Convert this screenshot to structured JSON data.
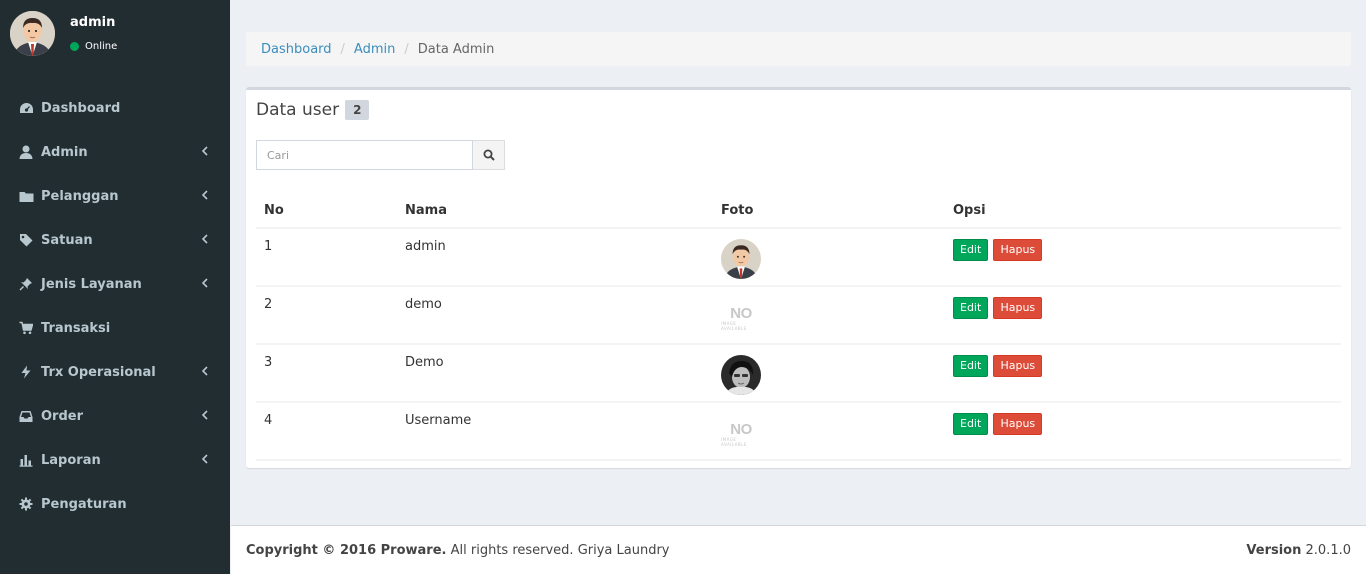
{
  "user": {
    "name": "admin",
    "status": "Online"
  },
  "sidebar": {
    "items": [
      {
        "label": "Dashboard",
        "icon": "dashboard-icon",
        "has_submenu": false
      },
      {
        "label": "Admin",
        "icon": "user-icon",
        "has_submenu": true
      },
      {
        "label": "Pelanggan",
        "icon": "folder-icon",
        "has_submenu": true
      },
      {
        "label": "Satuan",
        "icon": "tag-icon",
        "has_submenu": true
      },
      {
        "label": "Jenis Layanan",
        "icon": "thumbtack-icon",
        "has_submenu": true
      },
      {
        "label": "Transaksi",
        "icon": "cart-icon",
        "has_submenu": false
      },
      {
        "label": "Trx Operasional",
        "icon": "bolt-icon",
        "has_submenu": true
      },
      {
        "label": "Order",
        "icon": "inbox-icon",
        "has_submenu": true
      },
      {
        "label": "Laporan",
        "icon": "bar-chart-icon",
        "has_submenu": true
      },
      {
        "label": "Pengaturan",
        "icon": "gear-icon",
        "has_submenu": false
      }
    ]
  },
  "breadcrumb": {
    "items": [
      "Dashboard",
      "Admin"
    ],
    "active": "Data Admin"
  },
  "box": {
    "title": "Data user",
    "badge": "2",
    "search_placeholder": "Cari",
    "search_value": ""
  },
  "table": {
    "headers": [
      "No",
      "Nama",
      "Foto",
      "Opsi"
    ],
    "rows": [
      {
        "no": "1",
        "nama": "admin",
        "foto": "avatar-cartoon"
      },
      {
        "no": "2",
        "nama": "demo",
        "foto": "no-image"
      },
      {
        "no": "3",
        "nama": "Demo",
        "foto": "avatar-photo"
      },
      {
        "no": "4",
        "nama": "Username",
        "foto": "no-image"
      }
    ],
    "edit_label": "Edit",
    "delete_label": "Hapus",
    "no_image_text": "NO",
    "no_image_sub": "IMAGE AVAILABLE"
  },
  "footer": {
    "copyright_bold": "Copyright © 2016 Proware.",
    "copyright_rest": " All rights reserved. Griya Laundry",
    "version_label": "Version",
    "version_value": " 2.0.1.0"
  },
  "colors": {
    "sidebar_bg": "#222d32",
    "link": "#3c8dbc",
    "edit": "#00a65a",
    "delete": "#dd4b39",
    "online": "#00a65a"
  }
}
